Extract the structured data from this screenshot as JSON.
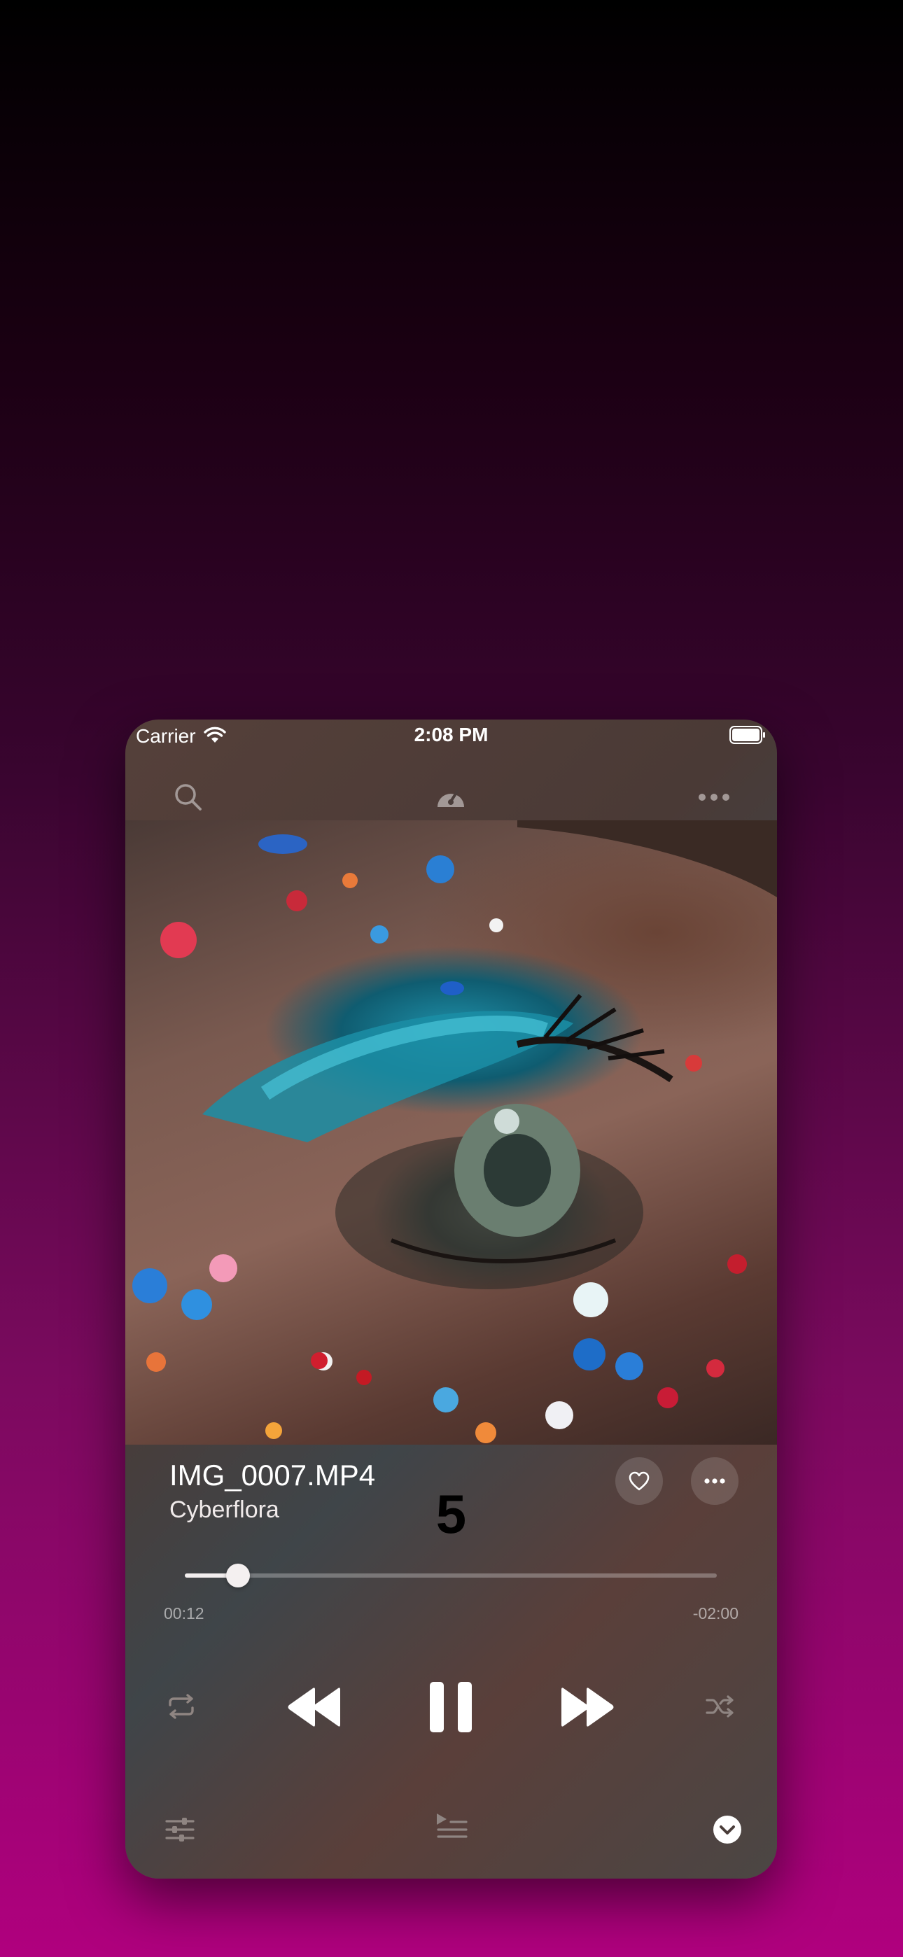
{
  "status_bar": {
    "carrier": "Carrier",
    "time": "2:08 PM",
    "wifi_icon": "wifi-icon",
    "battery_icon": "battery-full-icon"
  },
  "top_bar": {
    "search_icon": "search-icon",
    "speed_icon": "speedometer-icon",
    "more_icon": "ellipsis-icon"
  },
  "artwork": {
    "description_icon": "album-artwork-image"
  },
  "track": {
    "title": "IMG_0007.MP4",
    "artist": "Cyberflora",
    "overlay_number": "5"
  },
  "actions": {
    "favorite_icon": "heart-icon",
    "menu_icon": "ellipsis-icon"
  },
  "progress": {
    "elapsed": "00:12",
    "remaining": "-02:00",
    "fraction": 0.1
  },
  "controls": {
    "repeat_icon": "repeat-icon",
    "rewind_icon": "backward-icon",
    "pause_icon": "pause-icon",
    "forward_icon": "forward-icon",
    "shuffle_icon": "shuffle-icon"
  },
  "bottom_bar": {
    "equalizer_icon": "sliders-icon",
    "queue_icon": "queue-icon",
    "dismiss_icon": "chevron-down-circle-icon"
  },
  "colors": {
    "background_top": "#000000",
    "background_bottom": "#b0007e",
    "player_panel": "#4a3d3a",
    "text_primary": "#ffffff"
  }
}
